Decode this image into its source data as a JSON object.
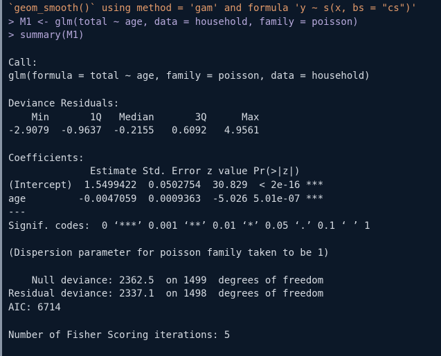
{
  "console": {
    "lines": [
      {
        "text": "`geom_smooth()` using method = 'gam' and formula 'y ~ s(x, bs = \"cs\")'",
        "kind": "warn"
      },
      {
        "text": "> M1 <- glm(total ~ age, data = household, family = poisson)",
        "kind": "cmd"
      },
      {
        "text": "> summary(M1)",
        "kind": "cmd"
      },
      {
        "text": "",
        "kind": "out"
      },
      {
        "text": "Call:",
        "kind": "out"
      },
      {
        "text": "glm(formula = total ~ age, family = poisson, data = household)",
        "kind": "out"
      },
      {
        "text": "",
        "kind": "out"
      },
      {
        "text": "Deviance Residuals:",
        "kind": "out"
      },
      {
        "text": "    Min       1Q   Median       3Q      Max  ",
        "kind": "out"
      },
      {
        "text": "-2.9079  -0.9637  -0.2155   0.6092   4.9561  ",
        "kind": "out"
      },
      {
        "text": "",
        "kind": "out"
      },
      {
        "text": "Coefficients:",
        "kind": "out"
      },
      {
        "text": "              Estimate Std. Error z value Pr(>|z|)    ",
        "kind": "out"
      },
      {
        "text": "(Intercept)  1.5499422  0.0502754  30.829  < 2e-16 ***",
        "kind": "out"
      },
      {
        "text": "age         -0.0047059  0.0009363  -5.026 5.01e-07 ***",
        "kind": "out"
      },
      {
        "text": "---",
        "kind": "out"
      },
      {
        "text": "Signif. codes:  0 ‘***’ 0.001 ‘**’ 0.01 ‘*’ 0.05 ‘.’ 0.1 ‘ ’ 1",
        "kind": "out"
      },
      {
        "text": "",
        "kind": "out"
      },
      {
        "text": "(Dispersion parameter for poisson family taken to be 1)",
        "kind": "out"
      },
      {
        "text": "",
        "kind": "out"
      },
      {
        "text": "    Null deviance: 2362.5  on 1499  degrees of freedom",
        "kind": "out"
      },
      {
        "text": "Residual deviance: 2337.1  on 1498  degrees of freedom",
        "kind": "out"
      },
      {
        "text": "AIC: 6714",
        "kind": "out"
      },
      {
        "text": "",
        "kind": "out"
      },
      {
        "text": "Number of Fisher Scoring iterations: 5",
        "kind": "out"
      }
    ]
  }
}
